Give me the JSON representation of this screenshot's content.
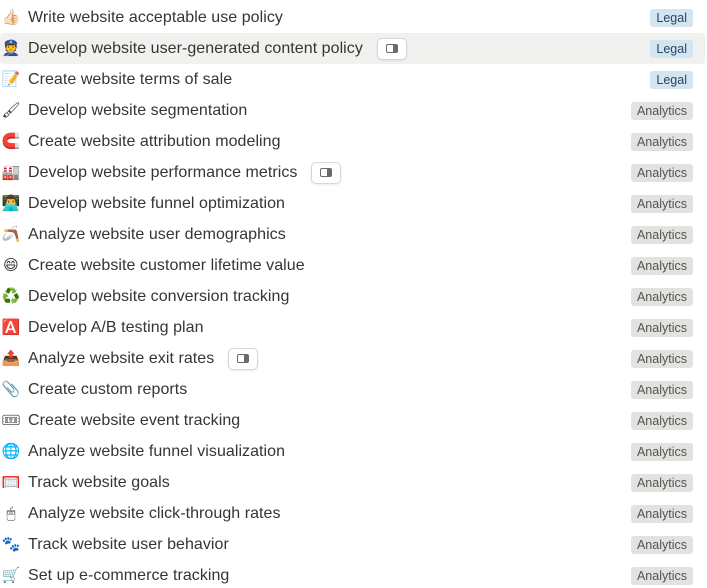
{
  "colors": {
    "legal_bg": "#d3e5ef",
    "legal_text": "#28456c",
    "analytics_bg": "#e3e2e0",
    "analytics_text": "#555450",
    "hover_bg": "#f1f1ef"
  },
  "rows": [
    {
      "icon_name": "thumbs-up-icon",
      "icon": "👍🏻",
      "title": "Write website acceptable use policy",
      "tag": "Legal",
      "tag_type": "legal"
    },
    {
      "icon_name": "police-officer-icon",
      "icon": "👮",
      "title": "Develop website user-generated content policy",
      "tag": "Legal",
      "tag_type": "legal",
      "peek": true,
      "hovered": true
    },
    {
      "icon_name": "memo-icon",
      "icon": "📝",
      "title": "Create website terms of sale",
      "tag": "Legal",
      "tag_type": "legal"
    },
    {
      "icon_name": "paintbrush-icon",
      "icon": "🖌",
      "title": "Develop website segmentation",
      "tag": "Analytics",
      "tag_type": "analytics"
    },
    {
      "icon_name": "magnet-icon",
      "icon": "🧲",
      "title": "Create website attribution modeling",
      "tag": "Analytics",
      "tag_type": "analytics"
    },
    {
      "icon_name": "factory-icon",
      "icon": "🏭",
      "title": "Develop website performance metrics",
      "tag": "Analytics",
      "tag_type": "analytics",
      "peek": true
    },
    {
      "icon_name": "technologist-icon",
      "icon": "👨‍💻",
      "title": "Develop website funnel optimization",
      "tag": "Analytics",
      "tag_type": "analytics"
    },
    {
      "icon_name": "boomerang-icon",
      "icon": "🪃",
      "title": "Analyze website user demographics",
      "tag": "Analytics",
      "tag_type": "analytics"
    },
    {
      "icon_name": "grinning-face-icon",
      "icon": "😄",
      "title": "Create website customer lifetime value",
      "tag": "Analytics",
      "tag_type": "analytics"
    },
    {
      "icon_name": "recycling-icon",
      "icon": "♻️",
      "title": "Develop website conversion tracking",
      "tag": "Analytics",
      "tag_type": "analytics"
    },
    {
      "icon_name": "letter-a-button-icon",
      "icon": "🅰️",
      "title": "Develop A/B testing plan",
      "tag": "Analytics",
      "tag_type": "analytics"
    },
    {
      "icon_name": "outbox-tray-icon",
      "icon": "📤",
      "title": "Analyze website exit rates",
      "tag": "Analytics",
      "tag_type": "analytics",
      "peek": true
    },
    {
      "icon_name": "paperclip-icon",
      "icon": "📎",
      "title": "Create custom reports",
      "tag": "Analytics",
      "tag_type": "analytics"
    },
    {
      "icon_name": "ticket-icon",
      "icon": "🎟",
      "title": "Create website event tracking",
      "tag": "Analytics",
      "tag_type": "analytics"
    },
    {
      "icon_name": "globe-icon",
      "icon": "🌐",
      "title": "Analyze website funnel visualization",
      "tag": "Analytics",
      "tag_type": "analytics"
    },
    {
      "icon_name": "goal-net-icon",
      "icon": "🥅",
      "title": "Track website goals",
      "tag": "Analytics",
      "tag_type": "analytics"
    },
    {
      "icon_name": "computer-mouse-icon",
      "icon": "🖱",
      "title": "Analyze website click-through rates",
      "tag": "Analytics",
      "tag_type": "analytics"
    },
    {
      "icon_name": "paw-prints-icon",
      "icon": "🐾",
      "title": "Track website user behavior",
      "tag": "Analytics",
      "tag_type": "analytics"
    },
    {
      "icon_name": "shopping-cart-icon",
      "icon": "🛒",
      "title": "Set up e-commerce tracking",
      "tag": "Analytics",
      "tag_type": "analytics"
    }
  ]
}
